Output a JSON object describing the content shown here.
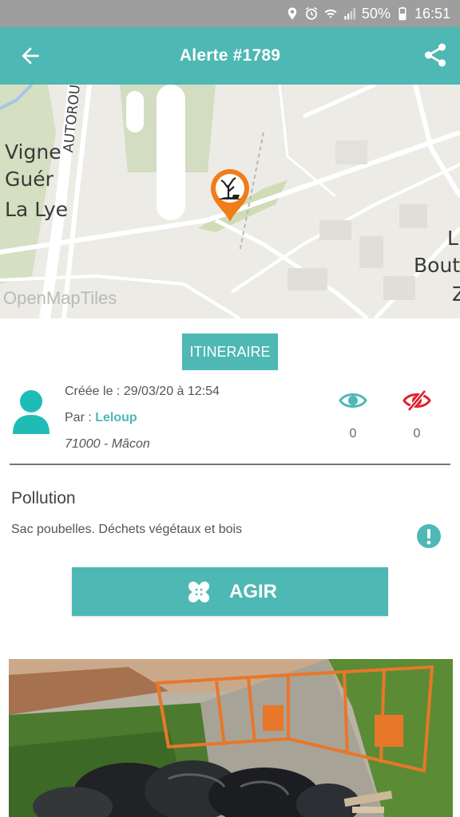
{
  "statusbar": {
    "battery": "50%",
    "time": "16:51",
    "icons": [
      "location-icon",
      "alarm-icon",
      "wifi-icon",
      "signal-icon",
      "battery-icon"
    ]
  },
  "appbar": {
    "title": "Alerte #1789",
    "back_icon": "arrow-left-icon",
    "share_icon": "share-icon"
  },
  "map": {
    "labels": [
      "Vigne",
      "Guér",
      "La Lye",
      "AUTOROU",
      "L",
      "Bout",
      "Z"
    ],
    "attribution": "OpenMapTiles",
    "marker_icon": "dead-tree-pollution-icon"
  },
  "itinerary": {
    "label": "ITINERAIRE"
  },
  "author": {
    "created": "Créée le : 29/03/20 à 12:54",
    "by_prefix": "Par : ",
    "by_name": "Leloup",
    "location": "71000 - Mâcon"
  },
  "stats": {
    "seen": "0",
    "unseen": "0"
  },
  "alert": {
    "category": "Pollution",
    "description": "Sac poubelles. Déchets végétaux et bois"
  },
  "action": {
    "label": "AGIR"
  },
  "colors": {
    "accent": "#4db8b4",
    "marker": "#f07d1a",
    "unseen": "#e0202a"
  }
}
